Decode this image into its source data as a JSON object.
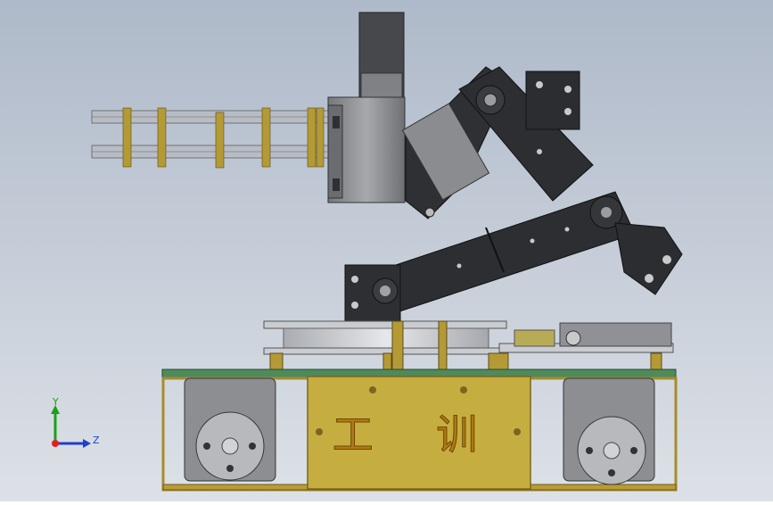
{
  "plate_text": "工 训",
  "triad": {
    "y_label": "Y",
    "z_label": "Z"
  },
  "colors": {
    "bg_top": "#b7c2d0",
    "bg_bottom": "#d8dde4",
    "dark_part": "#2d2f33",
    "servo_grey": "#8d8f93",
    "gold": "#c6ad3f",
    "pcb_green": "#4f8a5a",
    "frame_gold": "#b99c36"
  }
}
